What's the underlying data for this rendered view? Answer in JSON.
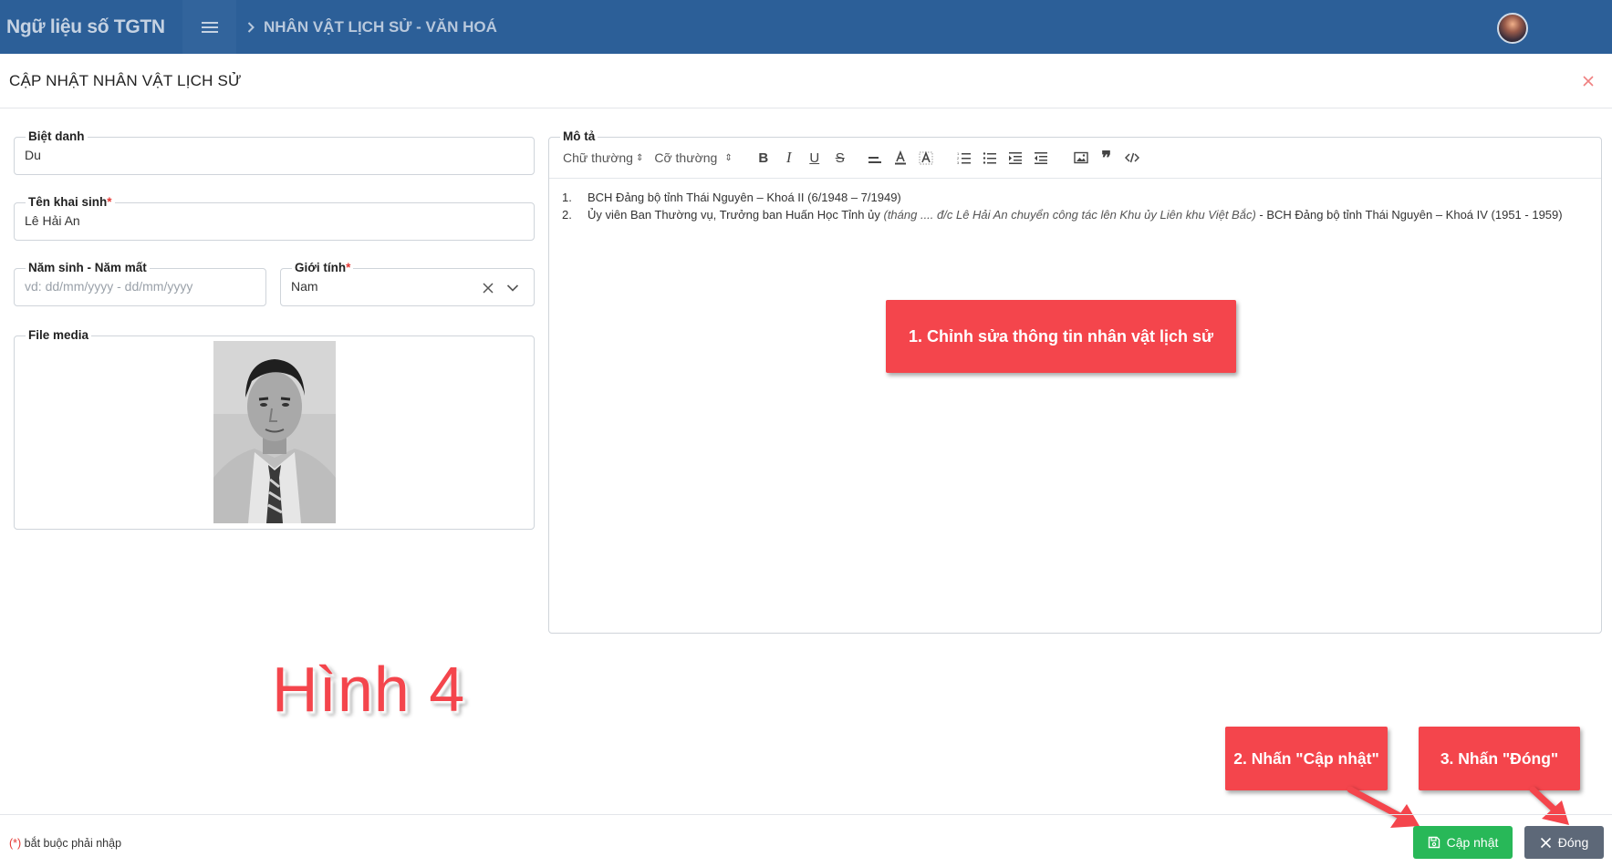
{
  "header": {
    "brand": "Ngữ liệu số TGTN",
    "breadcrumb": "NHÂN VẬT LỊCH SỬ - VĂN HOÁ"
  },
  "modal": {
    "title": "CẬP NHẬT NHÂN VẬT LỊCH SỬ"
  },
  "form": {
    "nickname_label": "Biệt danh",
    "nickname_value": "Du",
    "birthname_label": "Tên khai sinh",
    "birthname_value": "Lê Hải An",
    "required_mark": "*",
    "years_label": "Năm sinh - Năm mất",
    "years_placeholder": "vd: dd/mm/yyyy - dd/mm/yyyy",
    "gender_label": "Giới tính",
    "gender_value": "Nam",
    "media_label": "File media",
    "description_label": "Mô tả"
  },
  "editor": {
    "font_select": "Chữ thường",
    "size_select": "Cỡ thường",
    "items": [
      {
        "num": "1.",
        "text": "BCH Đảng bộ tỉnh Thái Nguyên – Khoá II (6/1948 – 7/1949)",
        "italic": "",
        "after": ""
      },
      {
        "num": "2.",
        "text": "Ủy viên Ban Thường vụ, Trưởng ban Huấn Học Tỉnh ủy ",
        "italic": "(tháng .... đ/c Lê Hải An chuyển công tác lên Khu ủy Liên khu Việt Bắc)",
        "after": " - BCH Đảng bộ tỉnh Thái Nguyên – Khoá IV (1951 - 1959)"
      }
    ]
  },
  "annotations": {
    "step1": "1. Chỉnh sửa thông tin nhân vật lịch sử",
    "step2": "2. Nhấn \"Cập nhật\"",
    "step3": "3. Nhấn \"Đóng\"",
    "figure_label": "Hình 4"
  },
  "footer": {
    "required_mark": "(*)",
    "required_note": " bắt buộc phải nhập",
    "update_button": "Cập nhật",
    "close_button": "Đóng"
  },
  "colors": {
    "topbar": "#2c5f98",
    "callout": "#f4454c",
    "update_button": "#28b858",
    "close_button": "#5d6878"
  }
}
